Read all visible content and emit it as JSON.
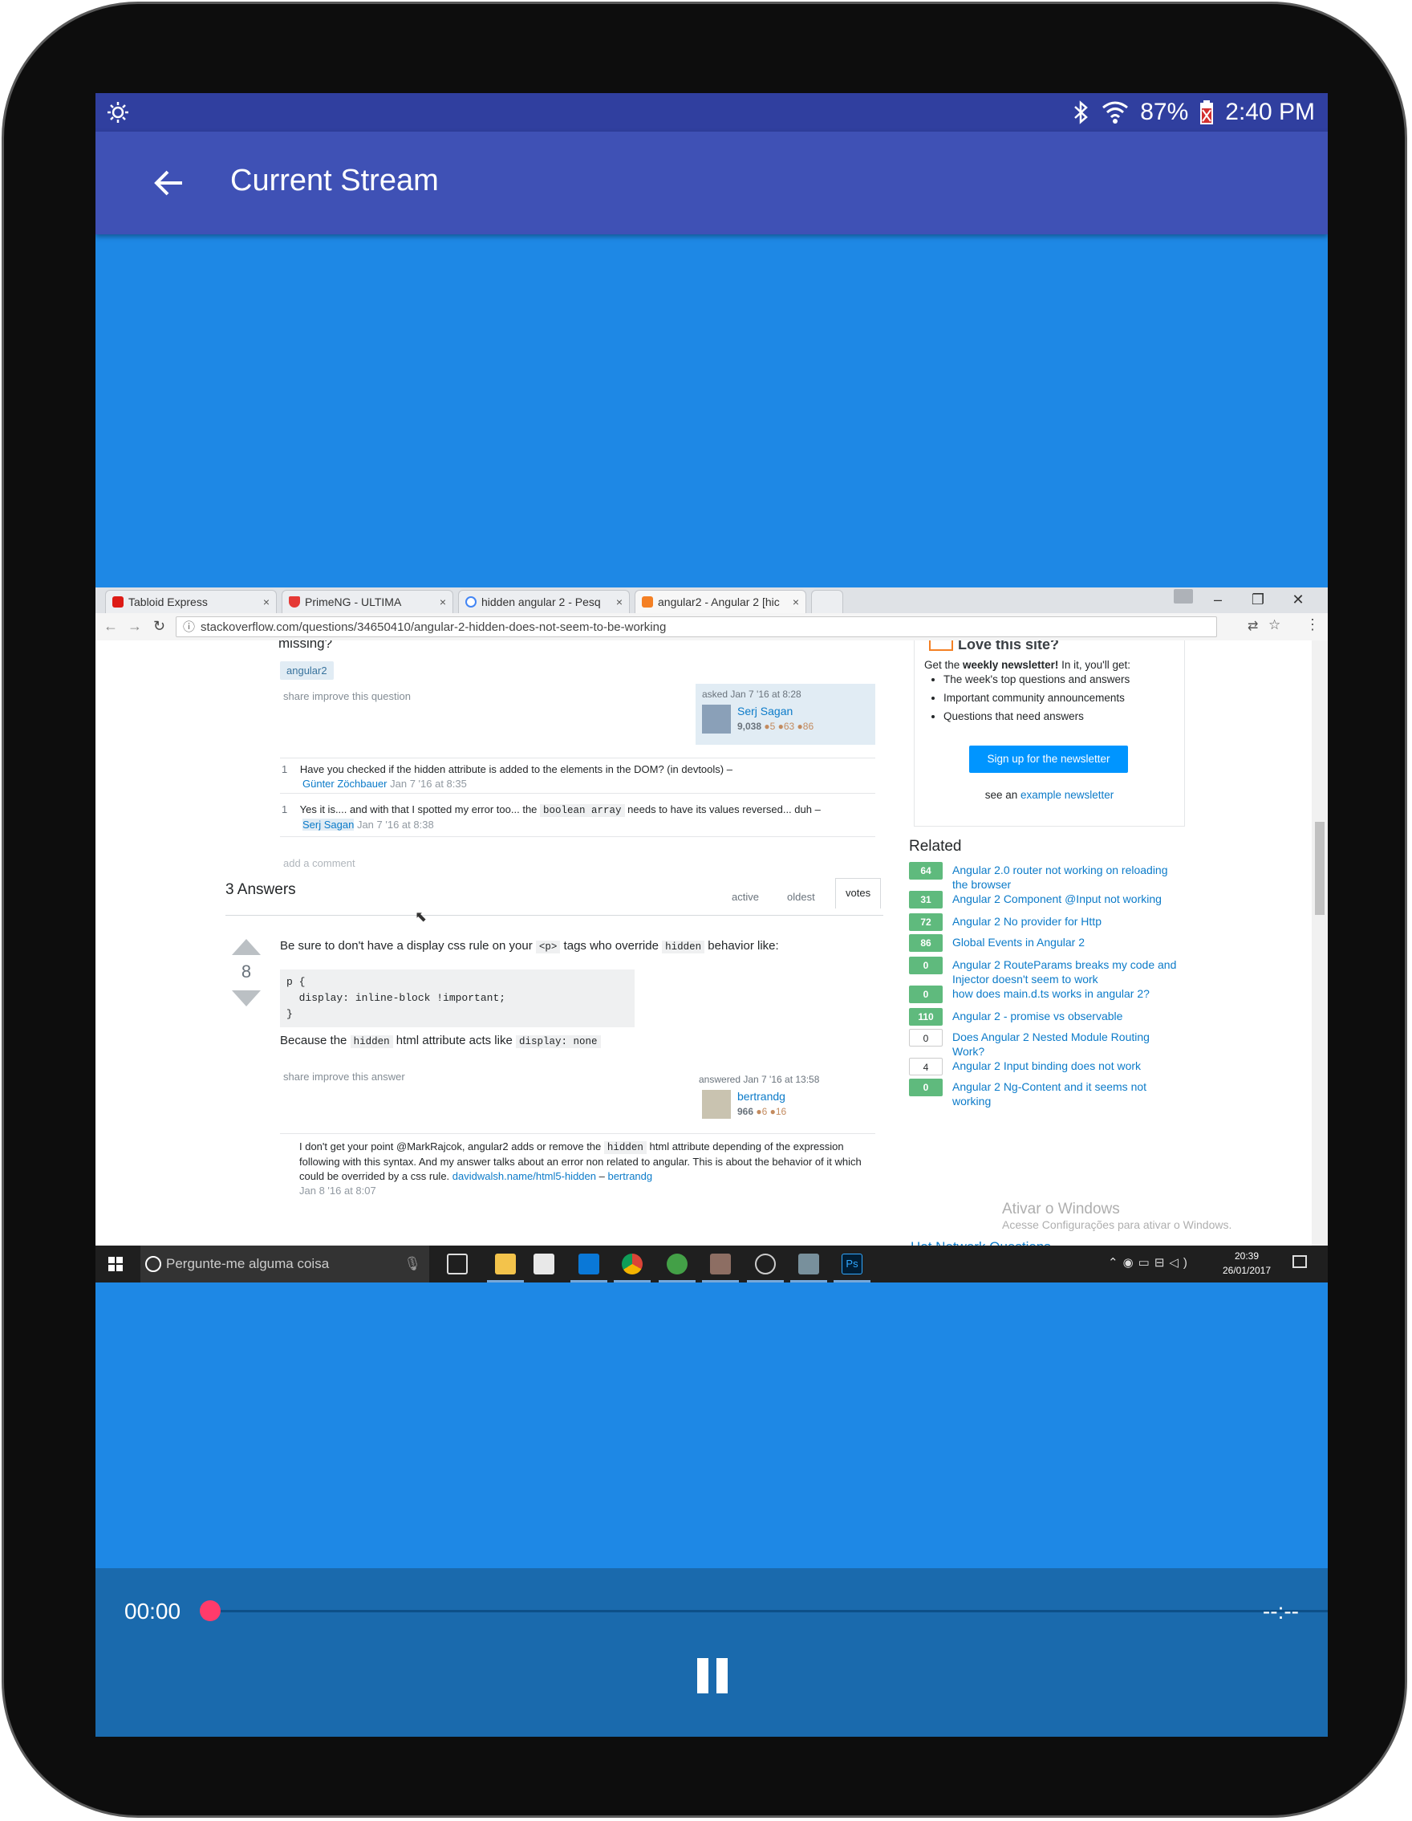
{
  "status_bar": {
    "battery": "87%",
    "time": "2:40 PM"
  },
  "app_bar": {
    "title": "Current Stream"
  },
  "browser": {
    "tabs": [
      {
        "label": "Tabloid Express",
        "close": "×"
      },
      {
        "label": "PrimeNG - ULTIMA",
        "close": "×"
      },
      {
        "label": "hidden angular 2 - Pesq",
        "close": "×"
      },
      {
        "label": "angular2 - Angular 2 [hic",
        "close": "×"
      }
    ],
    "url": "stackoverflow.com/questions/34650410/angular-2-hidden-does-not-seem-to-be-working",
    "window_controls": [
      "–",
      "❐",
      "✕"
    ]
  },
  "question": {
    "title_tail": "missing?",
    "tag": "angular2",
    "actions": "share  improve this question",
    "asked": "asked Jan 7 '16 at 8:28",
    "user": "Serj Sagan",
    "rep": "9,038",
    "badges": "●5 ●63 ●86",
    "comments": [
      {
        "score": "1",
        "text": "Have you checked if the hidden attribute is added to the elements in the DOM? (in devtools) –",
        "author": "Günter Zöchbauer",
        "date": "Jan 7 '16 at 8:35"
      },
      {
        "score": "1",
        "text_a": "Yes it is.... and with that I spotted my error too... the ",
        "code": "boolean array",
        "text_b": " needs to have its values reversed... duh –",
        "author": "Serj Sagan",
        "date": "Jan 7 '16 at 8:38"
      }
    ],
    "add_comment": "add a comment"
  },
  "answers": {
    "count": "3 Answers",
    "sort_tabs": [
      "active",
      "oldest",
      "votes"
    ],
    "vote_count": "8",
    "text_1a": "Be sure to don't have a display css rule on your ",
    "code_1": "<p>",
    "text_1b": " tags who override ",
    "code_2": "hidden",
    "text_1c": " behavior like:",
    "code_block": "p {\n  display: inline-block !important;\n}",
    "text_2a": "Because the ",
    "code_3": "hidden",
    "text_2b": " html attribute acts like ",
    "code_4": "display: none",
    "actions": "share  improve this answer",
    "answered": "answered Jan 7 '16 at 13:58",
    "user": "bertrandg",
    "rep": "966",
    "badges": "●6 ●16",
    "comment_a": "I don't get your point @MarkRajcok, angular2 adds or remove the ",
    "comment_code": "hidden",
    "comment_b": " html attribute depending of the expression following with this syntax. And my answer talks about an error non related to angular. This is about the behavior of it which could be overrided by a css rule. ",
    "comment_link": "davidwalsh.name/html5-hidden",
    "comment_author": "bertrandg",
    "comment_date": "Jan 8 '16 at 8:07"
  },
  "sidebar": {
    "newsletter_title": "Love this site?",
    "newsletter_sub_a": "Get the ",
    "newsletter_sub_b": "weekly newsletter!",
    "newsletter_sub_c": " In it, you'll get:",
    "newsletter_items": [
      "The week's top questions and answers",
      "Important community announcements",
      "Questions that need answers"
    ],
    "signup_button": "Sign up for the newsletter",
    "see_an": "see an ",
    "example": "example newsletter",
    "related_title": "Related",
    "related": [
      {
        "votes": "64",
        "text": "Angular 2.0 router not working on reloading the browser",
        "answered": true
      },
      {
        "votes": "31",
        "text": "Angular 2 Component @Input not working",
        "answered": true
      },
      {
        "votes": "72",
        "text": "Angular 2 No provider for Http",
        "answered": true
      },
      {
        "votes": "86",
        "text": "Global Events in Angular 2",
        "answered": true
      },
      {
        "votes": "0",
        "text": "Angular 2 RouteParams breaks my code and Injector doesn't seem to work",
        "answered": true
      },
      {
        "votes": "0",
        "text": "how does main.d.ts works in angular 2?",
        "answered": true
      },
      {
        "votes": "110",
        "text": "Angular 2 - promise vs observable",
        "answered": true
      },
      {
        "votes": "0",
        "text": "Does Angular 2 Nested Module Routing Work?",
        "answered": false
      },
      {
        "votes": "4",
        "text": "Angular 2 Input binding does not work",
        "answered": false
      },
      {
        "votes": "0",
        "text": "Angular 2 Ng-Content and it seems not working",
        "answered": true
      }
    ],
    "hot_network": "Hot Network Questions",
    "watermark_1": "Ativar o Windows",
    "watermark_2": "Acesse Configurações para ativar o Windows."
  },
  "taskbar": {
    "search_placeholder": "Pergunte-me alguma coisa",
    "clock_time": "20:39",
    "clock_date": "26/01/2017",
    "ps": "Ps"
  },
  "player": {
    "elapsed": "00:00",
    "duration": "--:--",
    "progress": 0
  },
  "colors": {
    "status_bar": "#303f9f",
    "app_bar": "#3f51b5",
    "stream_bg": "#1e88e5",
    "controls_bg": "#1a6aad",
    "seek_knob": "#ff3b6b"
  }
}
